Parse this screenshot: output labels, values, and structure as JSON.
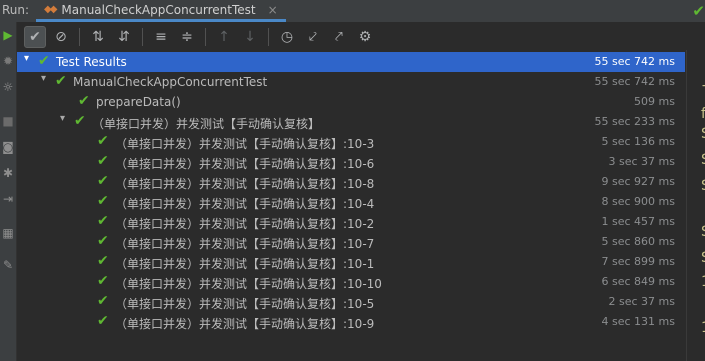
{
  "run_bar": {
    "label": "Run:",
    "tab_title": "ManualCheckAppConcurrentTest",
    "tab_close": "×"
  },
  "toolbar": {
    "buttons": [
      {
        "name": "show-passed-toggle",
        "icon": "check-icon",
        "glyph": "✔",
        "state": "on"
      },
      {
        "name": "show-ignored-toggle",
        "icon": "no-entry-icon",
        "glyph": "⊘",
        "state": "off"
      },
      {
        "name": "sort-alphabetically-button",
        "icon": "sort-alpha-icon",
        "glyph": "⇅",
        "state": "off"
      },
      {
        "name": "sort-by-duration-button",
        "icon": "sort-duration-icon",
        "glyph": "⇵",
        "state": "off"
      },
      {
        "name": "expand-all-button",
        "icon": "expand-all-icon",
        "glyph": "≡",
        "state": "off"
      },
      {
        "name": "collapse-all-button",
        "icon": "collapse-all-icon",
        "glyph": "≑",
        "state": "off"
      },
      {
        "name": "previous-failed-button",
        "icon": "arrow-up-icon",
        "glyph": "↑",
        "state": "disabled"
      },
      {
        "name": "next-failed-button",
        "icon": "arrow-down-icon",
        "glyph": "↓",
        "state": "disabled"
      },
      {
        "name": "test-history-button",
        "icon": "history-clock-icon",
        "glyph": "◷",
        "state": "off"
      },
      {
        "name": "import-tests-button",
        "icon": "import-icon",
        "glyph": "⤦",
        "state": "off"
      },
      {
        "name": "export-tests-button",
        "icon": "export-icon",
        "glyph": "⤤",
        "state": "off"
      },
      {
        "name": "settings-button",
        "icon": "gear-icon",
        "glyph": "⚙",
        "state": "off"
      }
    ]
  },
  "side_toolbar": {
    "icons": [
      {
        "name": "rerun-icon",
        "glyph": "▶",
        "color": "#5fb832"
      },
      {
        "name": "debug-icon",
        "glyph": "✹",
        "color": "#7a7a7a"
      },
      {
        "name": "coverage-icon",
        "glyph": "☼",
        "color": "#9a9a9a"
      },
      {
        "name": "stop-icon",
        "glyph": "■",
        "color": "#6b6b6b"
      },
      {
        "name": "camera-icon",
        "glyph": "◙",
        "color": "#8e8e8e"
      },
      {
        "name": "bug-settings-icon",
        "glyph": "✱",
        "color": "#8e8e8e"
      },
      {
        "name": "exit-icon",
        "glyph": "⇥",
        "color": "#8e8e8e"
      },
      {
        "name": "layout-icon",
        "glyph": "▦",
        "color": "#8e8e8e"
      },
      {
        "name": "pin-icon",
        "glyph": "✎",
        "color": "#8e8e8e"
      }
    ]
  },
  "tree": {
    "root": {
      "label": "Test Results",
      "time": "55 sec 742 ms"
    },
    "class_node": {
      "label": "ManualCheckAppConcurrentTest",
      "time": "55 sec 742 ms"
    },
    "setup_node": {
      "label": "prepareData()",
      "time": "509 ms"
    },
    "group_node": {
      "label": "（单接口并发）并发测试【手动确认复核】",
      "time": "55 sec 233 ms"
    },
    "cases": [
      {
        "label": "（单接口并发）并发测试【手动确认复核】:10-3",
        "time": "5 sec 136 ms"
      },
      {
        "label": "（单接口并发）并发测试【手动确认复核】:10-6",
        "time": "3 sec 37 ms"
      },
      {
        "label": "（单接口并发）并发测试【手动确认复核】:10-8",
        "time": "9 sec 927 ms"
      },
      {
        "label": "（单接口并发）并发测试【手动确认复核】:10-4",
        "time": "8 sec 900 ms"
      },
      {
        "label": "（单接口并发）并发测试【手动确认复核】:10-2",
        "time": "1 sec 457 ms"
      },
      {
        "label": "（单接口并发）并发测试【手动确认复核】:10-7",
        "time": "5 sec 860 ms"
      },
      {
        "label": "（单接口并发）并发测试【手动确认复核】:10-1",
        "time": "7 sec 899 ms"
      },
      {
        "label": "（单接口并发）并发测试【手动确认复核】:10-10",
        "time": "6 sec 849 ms"
      },
      {
        "label": "（单接口并发）并发测试【手动确认复核】:10-5",
        "time": "2 sec 37 ms"
      },
      {
        "label": "（单接口并发）并发测试【手动确认复核】:10-9",
        "time": "4 sec 131 ms"
      }
    ]
  },
  "console_edge": [
    "−",
    "f",
    "S",
    "S",
    "S",
    "S",
    "S",
    "1",
    "1"
  ],
  "colors": {
    "pass": "#5fb832",
    "selection": "#2f65ca",
    "tab_underline": "#4a88c7",
    "background": "#2b2b2b"
  }
}
